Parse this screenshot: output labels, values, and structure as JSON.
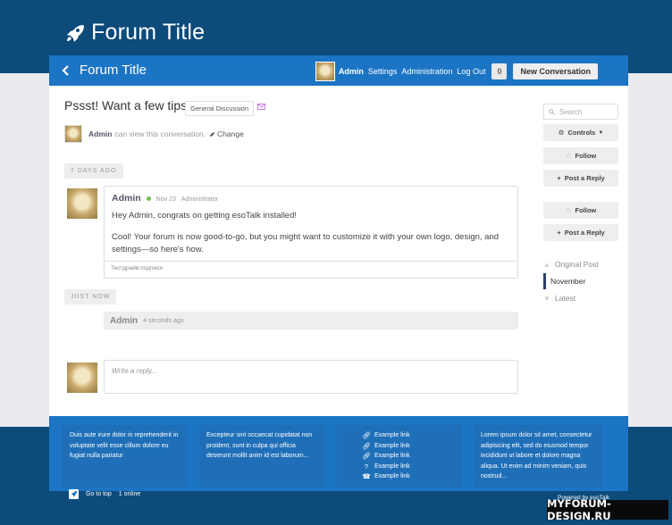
{
  "site": {
    "title": "Forum Title"
  },
  "header": {
    "back_title": "Forum Title",
    "user": "Admin",
    "links": [
      "Settings",
      "Administration",
      "Log Out"
    ],
    "notification_count": "0",
    "new_conversation": "New Conversation"
  },
  "conversation": {
    "title": "Pssst! Want a few tips?",
    "channel": "General Discussion",
    "permission_user": "Admin",
    "permission_text": "can view this conversation.",
    "change_label": "Change"
  },
  "separators": [
    "7 DAYS AGO",
    "JUST NOW"
  ],
  "post": {
    "author": "Admin",
    "date": "Nov 23",
    "role": "Administrator",
    "line1": "Hey Admin, congrats on getting esoTalk installed!",
    "line2": "Cool! Your forum is now good-to-go, but you might want to customize it with your own logo, design, and settings—so here's how.",
    "signature": "Тестдрайв подписи"
  },
  "reply_preview": {
    "author": "Admin",
    "time": "4 seconds ago"
  },
  "compose": {
    "placeholder": "Write a reply..."
  },
  "sidebar": {
    "search_placeholder": "Search",
    "controls": "Controls",
    "follow": "Follow",
    "post_reply": "Post a Reply",
    "timeline": [
      "Original Post",
      "November",
      "Latest"
    ]
  },
  "footer": {
    "col1": "Duis aute irure dolor in reprehenderit in voluptate velit esse cillum dolore eu fugiat nulla pariatur",
    "col2": "Excepteur sint occaecat cupidatat non proident, sunt in culpa qui officia deserunt mollit anim id est laborum...",
    "links": [
      "Example link",
      "Example link",
      "Example link",
      "Example link",
      "Example link"
    ],
    "col4": "Lorem ipsum dolor sit amet, consectetur adipisicing elit, sed do eiusmod tempor incididunt ut labore et dolore magna aliqua. Ut enim ad minim veniam, quis nostrud...",
    "go_to_top": "Go to top",
    "online": "1 online",
    "powered": "Powered by esoTalk"
  },
  "watermark": "MYFORUM-DESIGN.RU",
  "colors": {
    "top_band": "#0c4b7a",
    "header_bar": "#1b74c4",
    "footer": "#1b74c4",
    "online_dot": "#6bbf4e"
  },
  "icons": [
    "rocket-icon",
    "chevron-left-icon",
    "mail-icon",
    "pencil-icon",
    "search-icon",
    "gear-icon",
    "caret-down-icon",
    "star-icon",
    "plus-icon",
    "link-icon",
    "question-icon",
    "phone-icon"
  ]
}
